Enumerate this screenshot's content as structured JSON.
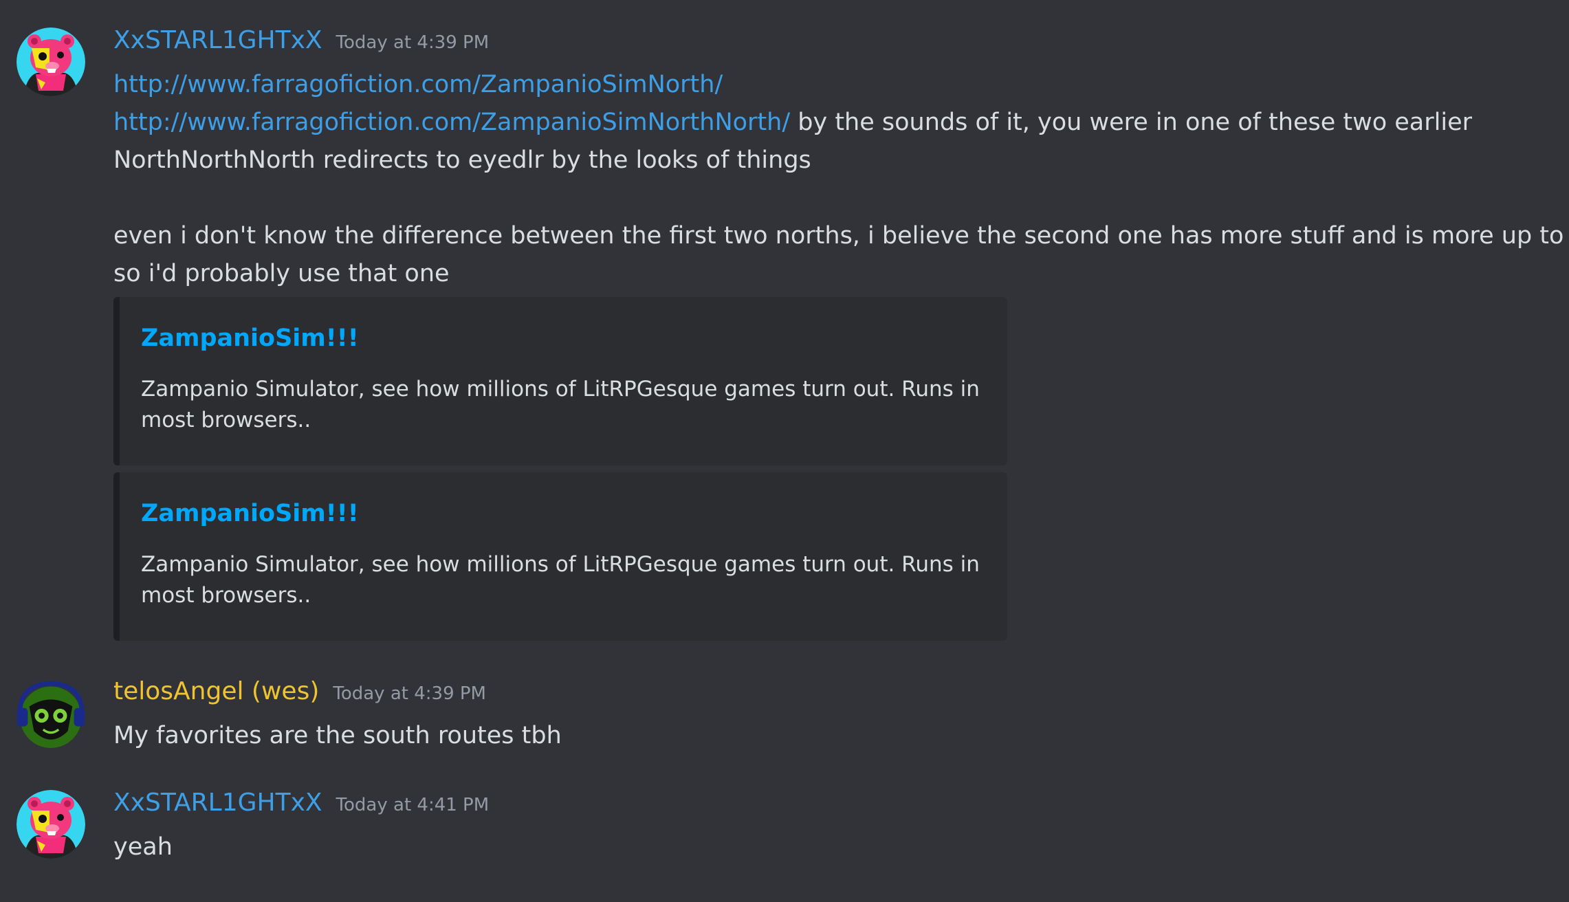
{
  "messages": [
    {
      "author": "XxSTARL1GHTxX",
      "timestamp": "Today at 4:39 PM",
      "author_color": "#3e9fe6",
      "avatar": "pink-bear-avatar",
      "link1": "http://www.farragofiction.com/ZampanioSimNorth/",
      "link2": "http://www.farragofiction.com/ZampanioSimNorthNorth/",
      "line2_text": " by the sounds of it, you were in one of these two earlier",
      "line3": "NorthNorthNorth redirects to eyedlr by the looks of things",
      "line5": "even i don't know the difference between the first two norths, i believe the second one has more stuff and is more up to date",
      "line6": "so i'd probably use that one",
      "embeds": [
        {
          "title": "ZampanioSim!!!",
          "description": "Zampanio Simulator, see how millions of LitRPGesque games turn out. Runs in most browsers.."
        },
        {
          "title": "ZampanioSim!!!",
          "description": "Zampanio Simulator, see how millions of LitRPGesque games turn out. Runs in most browsers.."
        }
      ]
    },
    {
      "author": "telosAngel (wes)",
      "timestamp": "Today at 4:39 PM",
      "author_color": "#f0c330",
      "avatar": "green-mask-avatar",
      "text": "My favorites are the south routes tbh"
    },
    {
      "author": "XxSTARL1GHTxX",
      "timestamp": "Today at 4:41 PM",
      "author_color": "#3e9fe6",
      "avatar": "pink-bear-avatar",
      "text": "yeah"
    }
  ]
}
